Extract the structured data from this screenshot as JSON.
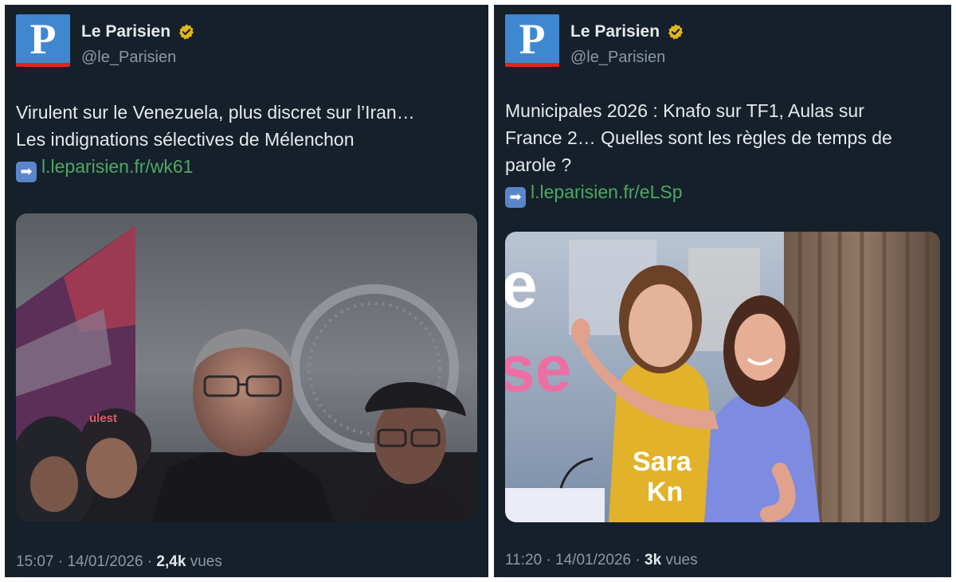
{
  "left": {
    "account": {
      "name": "Le Parisien",
      "handle": "@le_Parisien",
      "logo_letter": "P"
    },
    "text_lines": [
      "Virulent sur le Venezuela, plus discret sur l’Iran…",
      "Les indignations sélectives de Mélenchon"
    ],
    "arrow_icon": "➡",
    "link": "l.leparisien.fr/wk61",
    "image_text": "ulest",
    "footer": {
      "time": "15:07",
      "date": "14/01/2026",
      "views": "2,4k",
      "views_label": "vues",
      "separator": "·"
    }
  },
  "right": {
    "account": {
      "name": "Le Parisien",
      "handle": "@le_Parisien",
      "logo_letter": "P"
    },
    "text_lines": [
      "Municipales 2026 : Knafo sur TF1, Aulas sur",
      "France 2… Quelles sont les règles de temps de",
      "parole ?"
    ],
    "arrow_icon": "➡",
    "link": "l.leparisien.fr/eLSp",
    "image_text": {
      "big_e": "e",
      "big_se": "se",
      "poster_name1": "Sara",
      "poster_name2": "Kn"
    },
    "footer": {
      "time": "11:20",
      "date": "14/01/2026",
      "views": "3k",
      "views_label": "vues",
      "separator": "·"
    }
  },
  "colors": {
    "background": "#15202b",
    "text": "#e7e9ea",
    "muted": "#8b98a5",
    "link": "#4ea864",
    "logo_blue": "#3f88d0",
    "logo_red": "#e2231a",
    "verified_gold": "#e2b719"
  },
  "icons": [
    "logo-icon",
    "verified-badge-icon",
    "arrow-right-icon"
  ]
}
